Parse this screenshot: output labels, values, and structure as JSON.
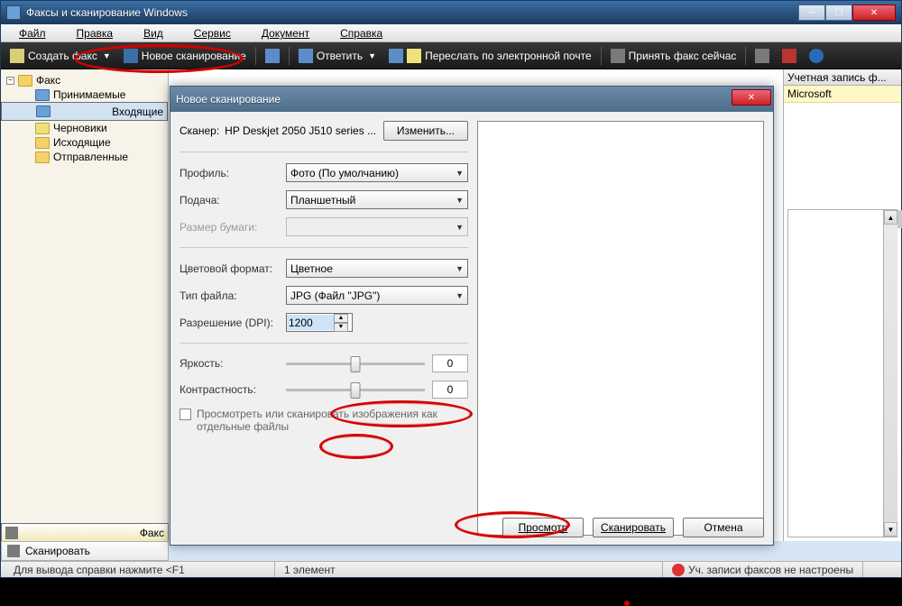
{
  "window": {
    "title": "Факсы и сканирование Windows"
  },
  "menu": {
    "file": "Файл",
    "edit": "Правка",
    "view": "Вид",
    "tools": "Сервис",
    "document": "Документ",
    "help": "Справка"
  },
  "toolbar": {
    "new_fax": "Создать факс",
    "new_scan": "Новое сканирование",
    "reply": "Ответить",
    "forward": "Переслать по электронной почте",
    "receive": "Принять факс сейчас"
  },
  "tree": {
    "root": "Факс",
    "incoming_queue": "Принимаемые",
    "inbox": "Входящие",
    "drafts": "Черновики",
    "outbox": "Исходящие",
    "sent": "Отправленные"
  },
  "tabs": {
    "fax": "Факс",
    "scan": "Сканировать"
  },
  "right": {
    "header": "Учетная запись ф...",
    "item": "Microsoft"
  },
  "status": {
    "help": "Для вывода справки нажмите <F1",
    "count": "1 элемент",
    "warn": "Уч. записи факсов не настроены"
  },
  "dialog": {
    "title": "Новое сканирование",
    "scanner_label": "Сканер:",
    "scanner_value": "HP Deskjet 2050 J510 series ...",
    "change": "Изменить...",
    "profile_label": "Профиль:",
    "profile_value": "Фото (По умолчанию)",
    "source_label": "Подача:",
    "source_value": "Планшетный",
    "papersize_label": "Размер бумаги:",
    "papersize_value": "",
    "colorfmt_label": "Цветовой формат:",
    "colorfmt_value": "Цветное",
    "filetype_label": "Тип файла:",
    "filetype_value": "JPG (Файл \"JPG\")",
    "dpi_label": "Разрешение (DPI):",
    "dpi_value": "1200",
    "brightness_label": "Яркость:",
    "brightness_value": "0",
    "contrast_label": "Контрастность:",
    "contrast_value": "0",
    "separate_label": "Просмотреть или сканировать изображения как отдельные файлы",
    "preview": "Просмотр",
    "scan": "Сканировать",
    "cancel": "Отмена"
  }
}
